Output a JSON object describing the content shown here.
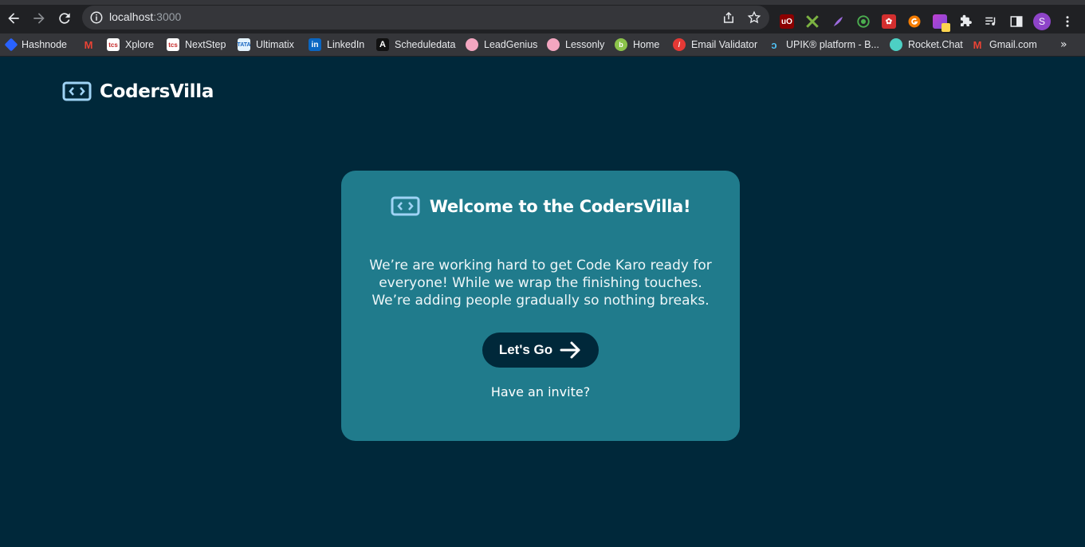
{
  "browser": {
    "url_host": "localhost",
    "url_port": ":3000",
    "profile_initial": "S",
    "bookmarks": [
      {
        "label": "Hashnode",
        "icon": "hashnode-icon",
        "color": "#2962ff"
      },
      {
        "label": "",
        "icon": "gmail-icon",
        "color": "#ea4335"
      },
      {
        "label": "Xplore",
        "icon": "tcs-icon",
        "color": "#e8eaed"
      },
      {
        "label": "NextStep",
        "icon": "tcs-icon",
        "color": "#e8eaed"
      },
      {
        "label": "Ultimatix",
        "icon": "tata-icon",
        "color": "#e8eaed"
      },
      {
        "label": "LinkedIn",
        "icon": "linkedin-icon",
        "color": "#0a66c2"
      },
      {
        "label": "Scheduledata",
        "icon": "angular-icon",
        "color": "#111111"
      },
      {
        "label": "LeadGenius",
        "icon": "brain-icon",
        "color": "#f3a6c0"
      },
      {
        "label": "Lessonly",
        "icon": "brain-icon",
        "color": "#f3a6c0"
      },
      {
        "label": "Home",
        "icon": "home-icon",
        "color": "#8bc34a"
      },
      {
        "label": "Email Validator",
        "icon": "validator-icon",
        "color": "#e53935"
      },
      {
        "label": "UPIK® platform - B...",
        "icon": "upik-icon",
        "color": "#4fc3f7"
      },
      {
        "label": "Rocket.Chat",
        "icon": "rocketchat-icon",
        "color": "#4dd0c4"
      },
      {
        "label": "Gmail.com",
        "icon": "gmail-icon",
        "color": "#ea4335"
      }
    ]
  },
  "header": {
    "brand": "CodersVilla"
  },
  "card": {
    "title": "Welcome to the CodersVilla!",
    "description": "We’re are working hard to get Code Karo ready for everyone! While we wrap the finishing touches. We’re adding people gradually so nothing breaks.",
    "cta_label": "Let's Go",
    "invite_link": "Have an invite?"
  },
  "colors": {
    "page_bg": "#00283a",
    "card_bg": "#207b8c",
    "button_bg": "#00283a",
    "logo_accent": "#9fd3f5"
  }
}
